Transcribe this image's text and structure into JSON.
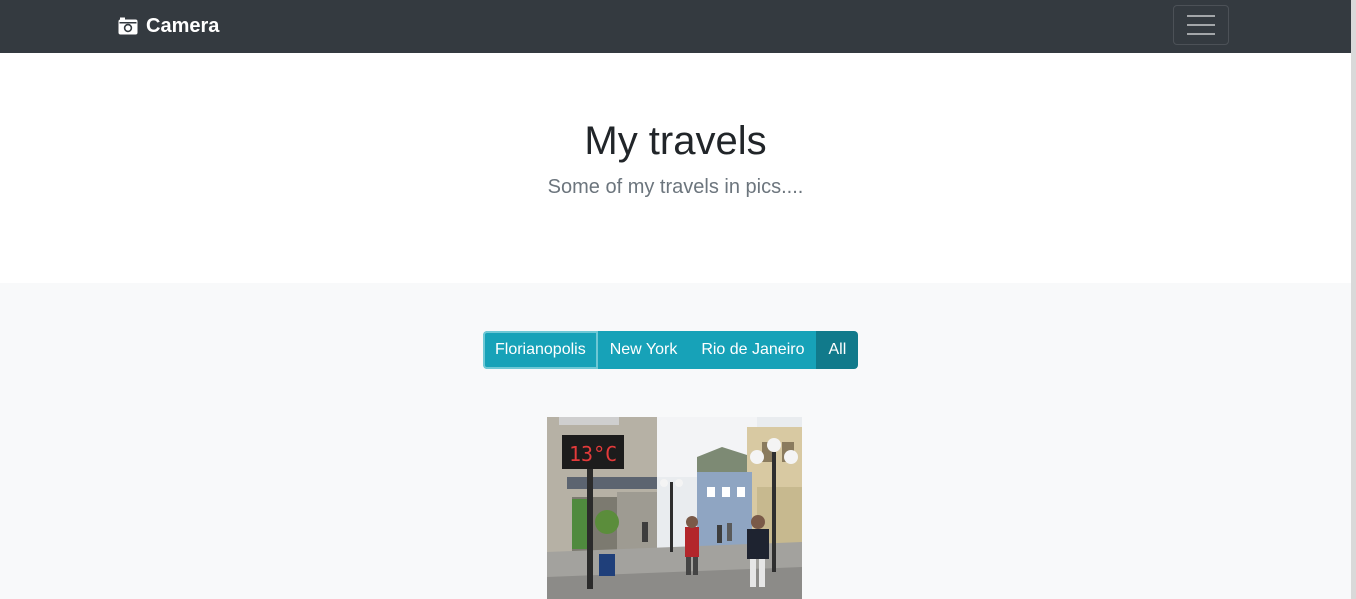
{
  "navbar": {
    "brand": "Camera",
    "brand_icon": "camera-icon",
    "toggle_icon": "hamburger-icon",
    "background": "#343a40"
  },
  "hero": {
    "title": "My travels",
    "subtitle": "Some of my travels in pics...."
  },
  "filters": {
    "items": [
      {
        "label": "Florianopolis",
        "state": "focused"
      },
      {
        "label": "New York",
        "state": "default"
      },
      {
        "label": "Rio de Janeiro",
        "state": "default"
      },
      {
        "label": "All",
        "state": "active"
      }
    ],
    "color": "#17a2b8",
    "active_color": "#117a8b"
  },
  "gallery": {
    "photos": [
      {
        "subject": "street-scene-photo",
        "sign_text": "13°C"
      }
    ]
  }
}
